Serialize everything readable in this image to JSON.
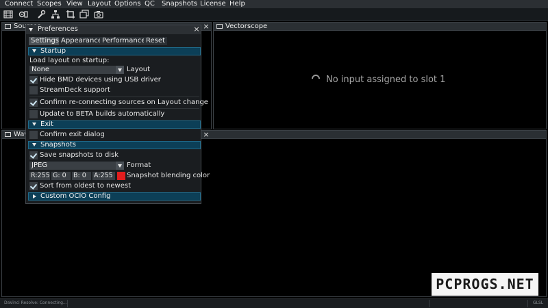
{
  "menubar": {
    "items": [
      "Connect",
      "Scopes",
      "View",
      "Layout",
      "Options",
      "QC",
      "Snapshots",
      "License",
      "Help"
    ]
  },
  "toolbar": {
    "icons": [
      "film-icon",
      "link-settings-icon",
      "wrench-icon",
      "network-icon",
      "crop-icon",
      "images-icon",
      "camera-icon"
    ]
  },
  "panels": {
    "sources": {
      "title": "Sources",
      "close": "×"
    },
    "vectorscope": {
      "title": "Vectorscope",
      "close": "×",
      "message": "No input assigned to slot 1"
    },
    "waveform": {
      "title": "Waveform",
      "close": "×"
    }
  },
  "preferences": {
    "title": "Preferences",
    "close": "×",
    "tabs": [
      "Settings",
      "Appearance",
      "Performance",
      "Reset"
    ],
    "active_tab": "Settings",
    "startup": {
      "header": "Startup",
      "load_layout_label": "Load layout on startup:",
      "layout_value": "None",
      "layout_label": "Layout",
      "hide_bmd": {
        "label": "Hide BMD devices using USB driver",
        "checked": true
      },
      "streamdeck": {
        "label": "StreamDeck support",
        "checked": false
      },
      "confirm_reconnect": {
        "label": "Confirm re-connecting sources on Layout change",
        "checked": true
      },
      "beta": {
        "label": "Update to BETA builds automatically",
        "checked": false
      }
    },
    "exit": {
      "header": "Exit",
      "confirm_exit": {
        "label": "Confirm exit dialog",
        "checked": false
      }
    },
    "snapshots": {
      "header": "Snapshots",
      "save_to_disk": {
        "label": "Save snapshots to disk",
        "checked": true
      },
      "format_value": "JPEG",
      "format_label": "Format",
      "r": "R:255",
      "g": "G:  0",
      "b": "B:  0",
      "a": "A:255",
      "blend_color": "#e21d1d",
      "blend_label": "Snapshot blending color",
      "sort": {
        "label": "Sort from oldest to newest",
        "checked": true
      }
    },
    "ocio": {
      "header": "Custom OCIO Config"
    }
  },
  "statusbar": {
    "left": "DaVinci Resolve: Connecting...",
    "right": "GLSL"
  },
  "watermark": {
    "text": "PCPROGS.NET"
  },
  "colors": {
    "section_bg": "#0c3f57",
    "accent_check": "#cfe8f5",
    "background": "#000000"
  }
}
